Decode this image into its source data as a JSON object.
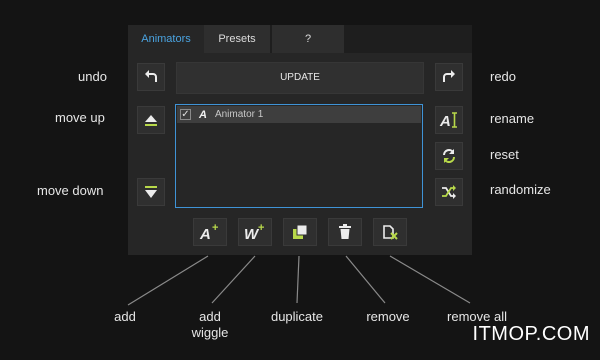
{
  "tabs": [
    {
      "label": "Animators"
    },
    {
      "label": "Presets"
    },
    {
      "label": "?"
    }
  ],
  "update_label": "UPDATE",
  "list_items": [
    {
      "checked": true,
      "glyph": "A",
      "label": "Animator 1"
    }
  ],
  "side_labels": {
    "undo": "undo",
    "redo": "redo",
    "move_up": "move up",
    "rename": "rename",
    "reset": "reset",
    "move_down": "move down",
    "randomize": "randomize"
  },
  "bottom_labels": {
    "add": "add",
    "add_wiggle_1": "add",
    "add_wiggle_2": "wiggle",
    "duplicate": "duplicate",
    "remove": "remove",
    "remove_all": "remove all"
  },
  "bottom_glyphs": {
    "add": "A",
    "add_wiggle": "W",
    "plus": "+"
  },
  "watermark": "ITMOP.COM",
  "colors": {
    "accent_blue": "#4aa3e0",
    "accent_green": "#b8d94a",
    "background": "#141414",
    "panel": "#262626"
  },
  "icons": {
    "undo": "undo-icon",
    "redo": "redo-icon",
    "move_up": "move-up-icon",
    "move_down": "move-down-icon",
    "rename": "rename-icon",
    "reset": "reset-icon",
    "randomize": "randomize-icon",
    "add": "add-animator-icon",
    "add_wiggle": "add-wiggle-icon",
    "duplicate": "duplicate-icon",
    "remove": "trash-icon",
    "remove_all": "remove-all-icon"
  }
}
